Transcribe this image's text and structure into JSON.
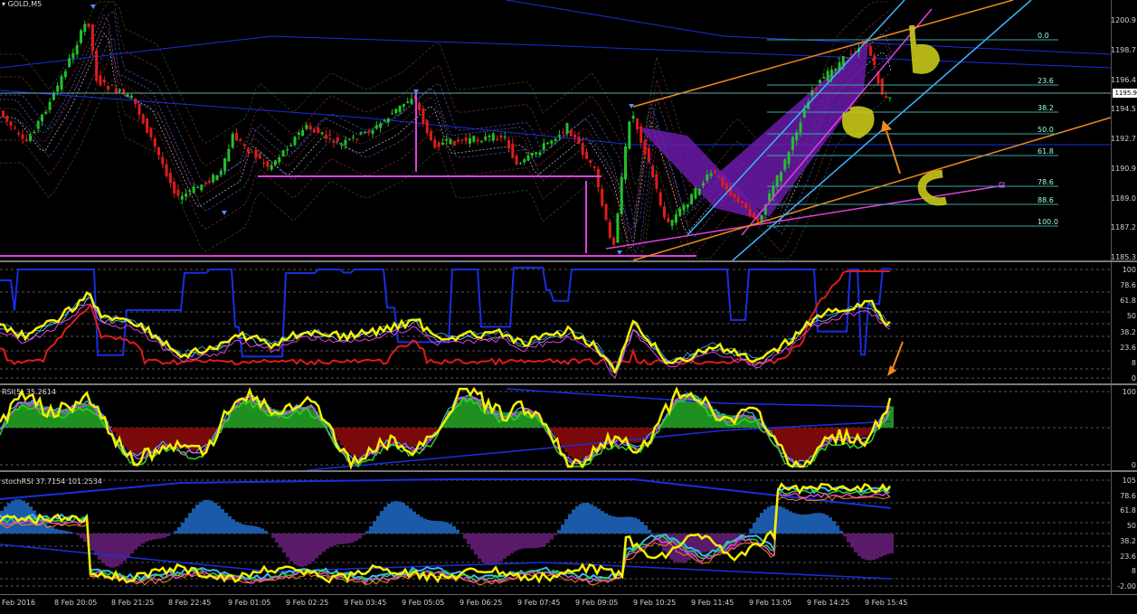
{
  "main": {
    "symbol": "GOLD,M5",
    "current_price": "1195.9",
    "price_scale": [
      "1200.9",
      "1198.7",
      "1196.4",
      "1194.5",
      "1192.7",
      "1190.9",
      "1189.0",
      "1187.2",
      "1185.3"
    ],
    "fib_levels": [
      "0.0",
      "23.6",
      "38.2",
      "50.0",
      "61.8",
      "78.6",
      "88.6",
      "100.0"
    ]
  },
  "osc1": {
    "scale": [
      "100",
      "78.6",
      "61.8",
      "50",
      "38.2",
      "23.6",
      "8",
      "0"
    ]
  },
  "rsi": {
    "label": "RSI(5) 35.2614",
    "scale": [
      "100",
      "0"
    ]
  },
  "stochrsi": {
    "label": "stochRSI 37.7154 101.2534",
    "scale": [
      "105",
      "78.6",
      "61.8",
      "50",
      "38.2",
      "23.6",
      "8",
      "-2.00"
    ]
  },
  "time_axis": [
    "Feb 2016",
    "8 Feb 20:05",
    "8 Feb 21:25",
    "8 Feb 22:45",
    "9 Feb 01:05",
    "9 Feb 02:25",
    "9 Feb 03:45",
    "9 Feb 05:05",
    "9 Feb 06:25",
    "9 Feb 07:45",
    "9 Feb 09:05",
    "9 Feb 10:25",
    "9 Feb 11:45",
    "9 Feb 13:05",
    "9 Feb 14:25",
    "9 Feb 15:45"
  ],
  "colors": {
    "bull": "#22c02a",
    "bear": "#e01b1b",
    "yellow": "#f6f000",
    "magenta": "#e040e0",
    "orange": "#f08a1a",
    "blue": "#1a2ee0",
    "cyan": "#3ab6ff",
    "purple": "#6a1aa8",
    "annotation": "#c8c81a"
  }
}
